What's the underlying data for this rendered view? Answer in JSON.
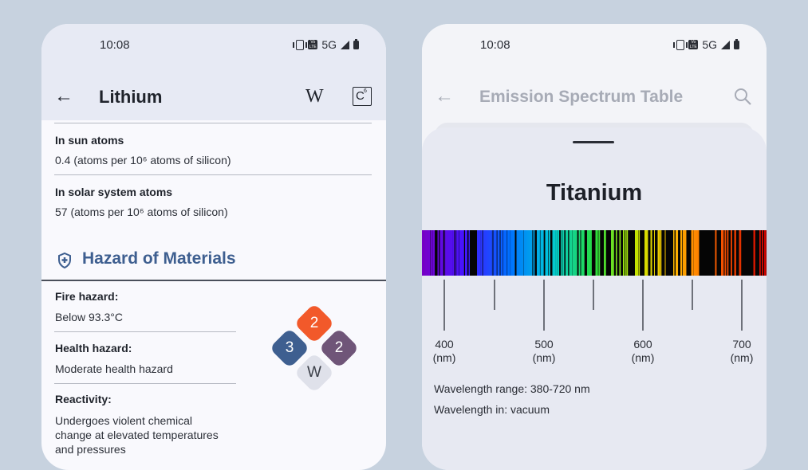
{
  "phone1": {
    "status": {
      "time": "10:08",
      "network": "5G"
    },
    "appbar": {
      "title": "Lithium",
      "back_icon": "arrow-left-icon",
      "wiki_label": "W",
      "c_label": "C",
      "c_superscript": "6"
    },
    "rows": [
      {
        "label": "In sun atoms",
        "value": "0.4 (atoms per 10⁶ atoms of silicon)"
      },
      {
        "label": "In solar system atoms",
        "value": "57 (atoms per 10⁶ atoms of silicon)"
      }
    ],
    "hazard": {
      "section_title": "Hazard of Materials",
      "fire_label": "Fire hazard:",
      "fire_value": "Below 93.3°C",
      "health_label": "Health hazard:",
      "health_value": "Moderate health hazard",
      "reactivity_label": "Reactivity:",
      "reactivity_value_lines": [
        "Undergoes violent chemical",
        "change at elevated temperatures",
        "and pressures"
      ],
      "nfpa": {
        "top": "2",
        "left": "3",
        "right": "2",
        "bottom": "W",
        "colors": {
          "top": "#f2592a",
          "left": "#3e5f90",
          "right": "#6f5578",
          "bottom": "#dfe1ea"
        }
      }
    }
  },
  "phone2": {
    "status": {
      "time": "10:08",
      "network": "5G"
    },
    "appbar": {
      "title": "Emission Spectrum Table",
      "back_icon": "arrow-left-icon",
      "search_icon": "search-icon"
    },
    "element": "Titanium",
    "ticks": [
      {
        "value": "400",
        "unit": "(nm)"
      },
      {
        "value": "500",
        "unit": "(nm)"
      },
      {
        "value": "600",
        "unit": "(nm)"
      },
      {
        "value": "700",
        "unit": "(nm)"
      }
    ],
    "wavelength_range": "Wavelength range: 380-720 nm",
    "wavelength_in": "Wavelength in: vacuum"
  }
}
